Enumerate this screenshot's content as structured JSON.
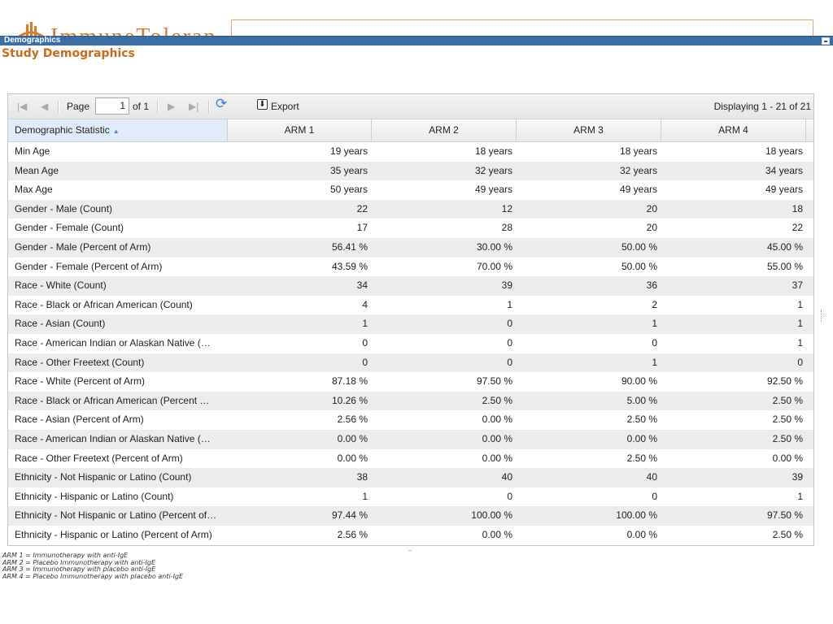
{
  "header": {
    "logo_text": "ImmuneTolerance",
    "panel_title": "Demographics",
    "page_title": "Study Demographics"
  },
  "toolbar": {
    "first_icon": "first-page-icon",
    "prev_icon": "prev-page-icon",
    "page_label": "Page",
    "page_value": "1",
    "of_label": "of 1",
    "next_icon": "next-page-icon",
    "last_icon": "last-page-icon",
    "refresh_icon": "refresh-icon",
    "export_label": "Export",
    "display_info": "Displaying 1 - 21 of 21"
  },
  "columns": [
    "Demographic Statistic",
    "ARM 1",
    "ARM 2",
    "ARM 3",
    "ARM 4"
  ],
  "rows": [
    [
      "Min Age",
      "19 years",
      "18 years",
      "18 years",
      "18 years"
    ],
    [
      "Mean Age",
      "35 years",
      "32 years",
      "32 years",
      "34 years"
    ],
    [
      "Max Age",
      "50 years",
      "49 years",
      "49 years",
      "49 years"
    ],
    [
      "Gender - Male (Count)",
      "22",
      "12",
      "20",
      "18"
    ],
    [
      "Gender - Female (Count)",
      "17",
      "28",
      "20",
      "22"
    ],
    [
      "Gender - Male (Percent of Arm)",
      "56.41 %",
      "30.00 %",
      "50.00 %",
      "45.00 %"
    ],
    [
      "Gender - Female (Percent of Arm)",
      "43.59 %",
      "70.00 %",
      "50.00 %",
      "55.00 %"
    ],
    [
      "Race - White (Count)",
      "34",
      "39",
      "36",
      "37"
    ],
    [
      "Race - Black or African American (Count)",
      "4",
      "1",
      "2",
      "1"
    ],
    [
      "Race - Asian (Count)",
      "1",
      "0",
      "1",
      "1"
    ],
    [
      "Race - American Indian or Alaskan Native (…",
      "0",
      "0",
      "0",
      "1"
    ],
    [
      "Race - Other Freetext (Count)",
      "0",
      "0",
      "1",
      "0"
    ],
    [
      "Race - White (Percent of Arm)",
      "87.18 %",
      "97.50 %",
      "90.00 %",
      "92.50 %"
    ],
    [
      "Race - Black or African American (Percent …",
      "10.26 %",
      "2.50 %",
      "5.00 %",
      "2.50 %"
    ],
    [
      "Race - Asian (Percent of Arm)",
      "2.56 %",
      "0.00 %",
      "2.50 %",
      "2.50 %"
    ],
    [
      "Race - American Indian or Alaskan Native (…",
      "0.00 %",
      "0.00 %",
      "0.00 %",
      "2.50 %"
    ],
    [
      "Race - Other Freetext (Percent of Arm)",
      "0.00 %",
      "0.00 %",
      "2.50 %",
      "0.00 %"
    ],
    [
      "Ethnicity - Not Hispanic or Latino (Count)",
      "38",
      "40",
      "40",
      "39"
    ],
    [
      "Ethnicity - Hispanic or Latino (Count)",
      "1",
      "0",
      "0",
      "1"
    ],
    [
      "Ethnicity - Not Hispanic or Latino (Percent of…",
      "97.44 %",
      "100.00 %",
      "100.00 %",
      "97.50 %"
    ],
    [
      "Ethnicity - Hispanic or Latino (Percent of Arm)",
      "2.56 %",
      "0.00 %",
      "0.00 %",
      "2.50 %"
    ]
  ],
  "legend": [
    "ARM 1 = Immunotherapy with anti-IgE",
    "ARM 2 = Placebo Immunotherapy with anti-IgE",
    "ARM 3 = Immunotherapy with placebo anti-IgE",
    "ARM 4 = Placebo Immunotherapy with placebo anti-IgE"
  ],
  "colors": {
    "titlebar": "#3a6ea5",
    "page_title": "#c96a1c",
    "alt_row": "#ececec"
  }
}
